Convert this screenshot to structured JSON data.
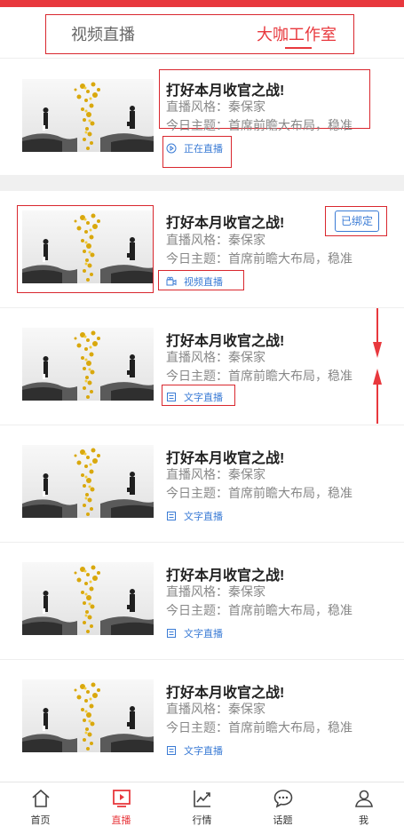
{
  "tabs": [
    {
      "label": "视频直播",
      "active": false
    },
    {
      "label": "大咖工作室",
      "active": true
    }
  ],
  "cards": [
    {
      "title": "打好本月收官之战!",
      "style": "直播风格：秦保家",
      "topic": "今日主题：首席前瞻大布局，稳准",
      "tag": "正在直播",
      "tag_icon": "play-circle-icon"
    },
    {
      "title": "打好本月收官之战!",
      "style": "直播风格：秦保家",
      "topic": "今日主题：首席前瞻大布局，稳准",
      "tag": "视频直播",
      "tag_icon": "video-camera-icon",
      "badge": "已绑定"
    },
    {
      "title": "打好本月收官之战!",
      "style": "直播风格：秦保家",
      "topic": "今日主题：首席前瞻大布局，稳准",
      "tag": "文字直播",
      "tag_icon": "document-icon"
    },
    {
      "title": "打好本月收官之战!",
      "style": "直播风格：秦保家",
      "topic": "今日主题：首席前瞻大布局，稳准",
      "tag": "文字直播",
      "tag_icon": "document-icon"
    },
    {
      "title": "打好本月收官之战!",
      "style": "直播风格：秦保家",
      "topic": "今日主题：首席前瞻大布局，稳准",
      "tag": "文字直播",
      "tag_icon": "document-icon"
    },
    {
      "title": "打好本月收官之战!",
      "style": "直播风格：秦保家",
      "topic": "今日主题：首席前瞻大布局，稳准",
      "tag": "文字直播",
      "tag_icon": "document-icon"
    }
  ],
  "nav": [
    {
      "label": "首页",
      "icon": "home-icon",
      "active": false
    },
    {
      "label": "直播",
      "icon": "live-play-icon",
      "active": true
    },
    {
      "label": "行情",
      "icon": "trend-chart-icon",
      "active": false
    },
    {
      "label": "话题",
      "icon": "chat-bubble-icon",
      "active": false
    },
    {
      "label": "我",
      "icon": "user-icon",
      "active": false
    }
  ],
  "colors": {
    "accent": "#e8383d",
    "link": "#3a7bd5",
    "annotation": "#d9272e"
  }
}
